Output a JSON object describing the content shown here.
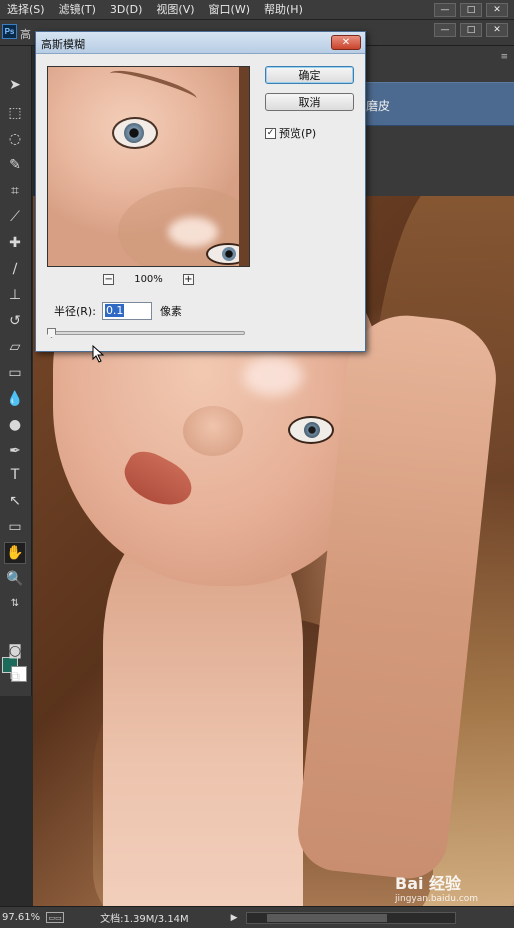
{
  "menubar": {
    "items": [
      "选择(S)",
      "滤镜(T)",
      "3D(D)",
      "视图(V)",
      "窗口(W)",
      "帮助(H)"
    ],
    "controls": [
      "—",
      "□",
      "✕"
    ]
  },
  "optbar": {
    "doc_tab": "高",
    "controls": [
      "—",
      "□",
      "✕"
    ]
  },
  "panel": {
    "layer_name": "磨皮"
  },
  "dialog": {
    "title": "高斯模糊",
    "close_label": "✕",
    "ok_label": "确定",
    "cancel_label": "取消",
    "preview_label": "预览(P)",
    "preview_checked": true,
    "zoom_level": "100%",
    "zoom_minus": "−",
    "zoom_plus": "+",
    "radius_label": "半径(R):",
    "radius_value": "0.1",
    "radius_unit": "像素",
    "slider_fraction": 0.0
  },
  "statusbar": {
    "zoom": "97.61%",
    "doc_info": "文档:1.39M/3.14M",
    "arrow": "▶"
  },
  "watermark": {
    "main": "Bai 经验",
    "sub": "jingyan.baidu.com"
  },
  "colors": {
    "foreground": "#1c6b5a",
    "background": "#ffffff",
    "accent": "#316ac5"
  }
}
